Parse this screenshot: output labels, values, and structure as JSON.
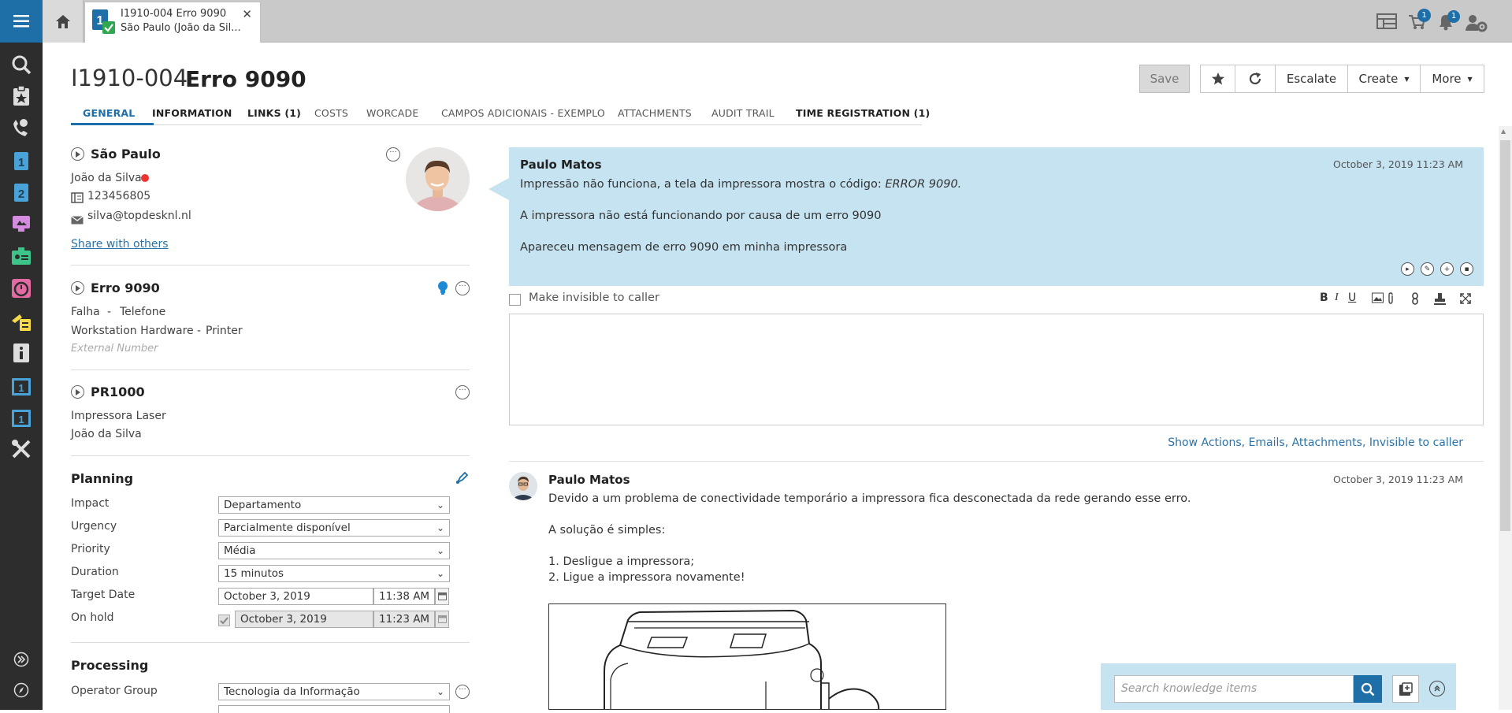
{
  "app": {
    "accent_color": "#1e6fa8",
    "leftbar_icons": [
      "menu-icon",
      "search-icon",
      "favorites-icon",
      "call-icon",
      "first-line-icon",
      "second-line-icon",
      "reservations-icon",
      "asset-icon",
      "timer-icon",
      "changes-icon",
      "info-icon",
      "incident-board-1-icon",
      "incident-board-2-icon",
      "tools-icon",
      "expand-icon",
      "compass-icon"
    ]
  },
  "topbar": {
    "tab_line1": "I1910-004 Erro 9090",
    "tab_line2": "São Paulo (João da Sil...",
    "cart_badge": "1",
    "bell_badge": "1"
  },
  "header": {
    "number": "I1910-004",
    "name": "Erro 9090",
    "buttons": {
      "save": "Save",
      "escalate": "Escalate",
      "create": "Create",
      "more": "More"
    }
  },
  "tabs": [
    "GENERAL",
    "INFORMATION",
    "LINKS (1)",
    "COSTS",
    "WORCADE",
    "CAMPOS ADICIONAIS - EXEMPLO",
    "ATTACHMENTS",
    "AUDIT TRAIL",
    "TIME REGISTRATION (1)"
  ],
  "caller": {
    "branch": "São Paulo",
    "name": "João da Silva",
    "phone": "123456805",
    "email": "silva@topdesknl.nl",
    "share_link": "Share with others"
  },
  "request": {
    "title": "Erro 9090",
    "category": "Falha",
    "subcategory": "Telefone",
    "object_type": "Workstation Hardware",
    "object_sub": "Printer",
    "external_number_placeholder": "External Number"
  },
  "object": {
    "title": "PR1000",
    "type": "Impressora Laser",
    "user": "João da Silva"
  },
  "planning": {
    "title": "Planning",
    "impact_label": "Impact",
    "impact_value": "Departamento",
    "urgency_label": "Urgency",
    "urgency_value": "Parcialmente disponível",
    "priority_label": "Priority",
    "priority_value": "Média",
    "duration_label": "Duration",
    "duration_value": "15 minutos",
    "target_label": "Target Date",
    "target_date": "October 3, 2019",
    "target_time": "11:38 AM",
    "onhold_label": "On hold",
    "onhold_date": "October 3, 2019",
    "onhold_time": "11:23 AM"
  },
  "processing": {
    "title": "Processing",
    "operator_group_label": "Operator Group",
    "operator_group_value": "Tecnologia da Informação"
  },
  "request_bubble": {
    "author": "Paulo Matos",
    "date": "October 3, 2019 11:23 AM",
    "line1_prefix": "Impressão não funciona, a tela da impressora mostra o código: ",
    "line1_code": "ERROR 9090.",
    "line2": "A impressora não está funcionando por causa de um erro 9090",
    "line3": "Apareceu mensagem de erro 9090 em minha impressora"
  },
  "editor": {
    "invisible_label": "Make invisible to caller",
    "show_actions_link": "Show Actions, Emails, Attachments, Invisible to caller"
  },
  "action": {
    "author": "Paulo Matos",
    "date": "October 3, 2019 11:23 AM",
    "line1": "Devido a um problema de conectividade temporário a impressora fica desconectada da rede gerando esse erro.",
    "line2": "A solução é simples:",
    "step1": "1. Desligue a impressora;",
    "step2": "2. Ligue a impressora novamente!"
  },
  "knowledge": {
    "search_placeholder": "Search knowledge items"
  }
}
